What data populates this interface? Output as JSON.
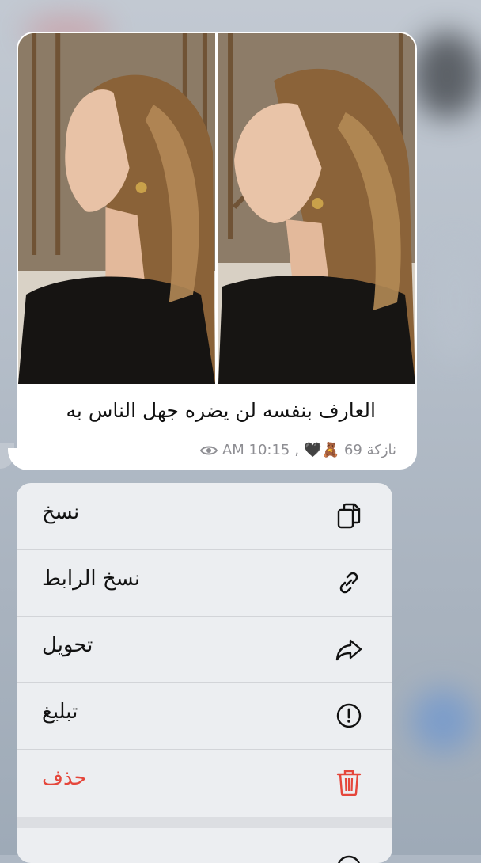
{
  "message": {
    "caption": "العارف بنفسه لن يضره جهل الناس به",
    "views": "69 نازكة",
    "reactions": "🖤🧸",
    "time": "AM 10:15",
    "separator": ","
  },
  "menu": {
    "items": [
      {
        "label": "نسخ",
        "icon": "copy-icon"
      },
      {
        "label": "نسخ الرابط",
        "icon": "link-icon"
      },
      {
        "label": "تحويل",
        "icon": "forward-icon"
      },
      {
        "label": "تبليغ",
        "icon": "report-icon"
      },
      {
        "label": "حذف",
        "icon": "trash-icon",
        "color": "#e5463b"
      }
    ]
  },
  "colors": {
    "danger": "#e5463b",
    "menu_bg": "#eceef1",
    "bubble": "#ffffff"
  }
}
